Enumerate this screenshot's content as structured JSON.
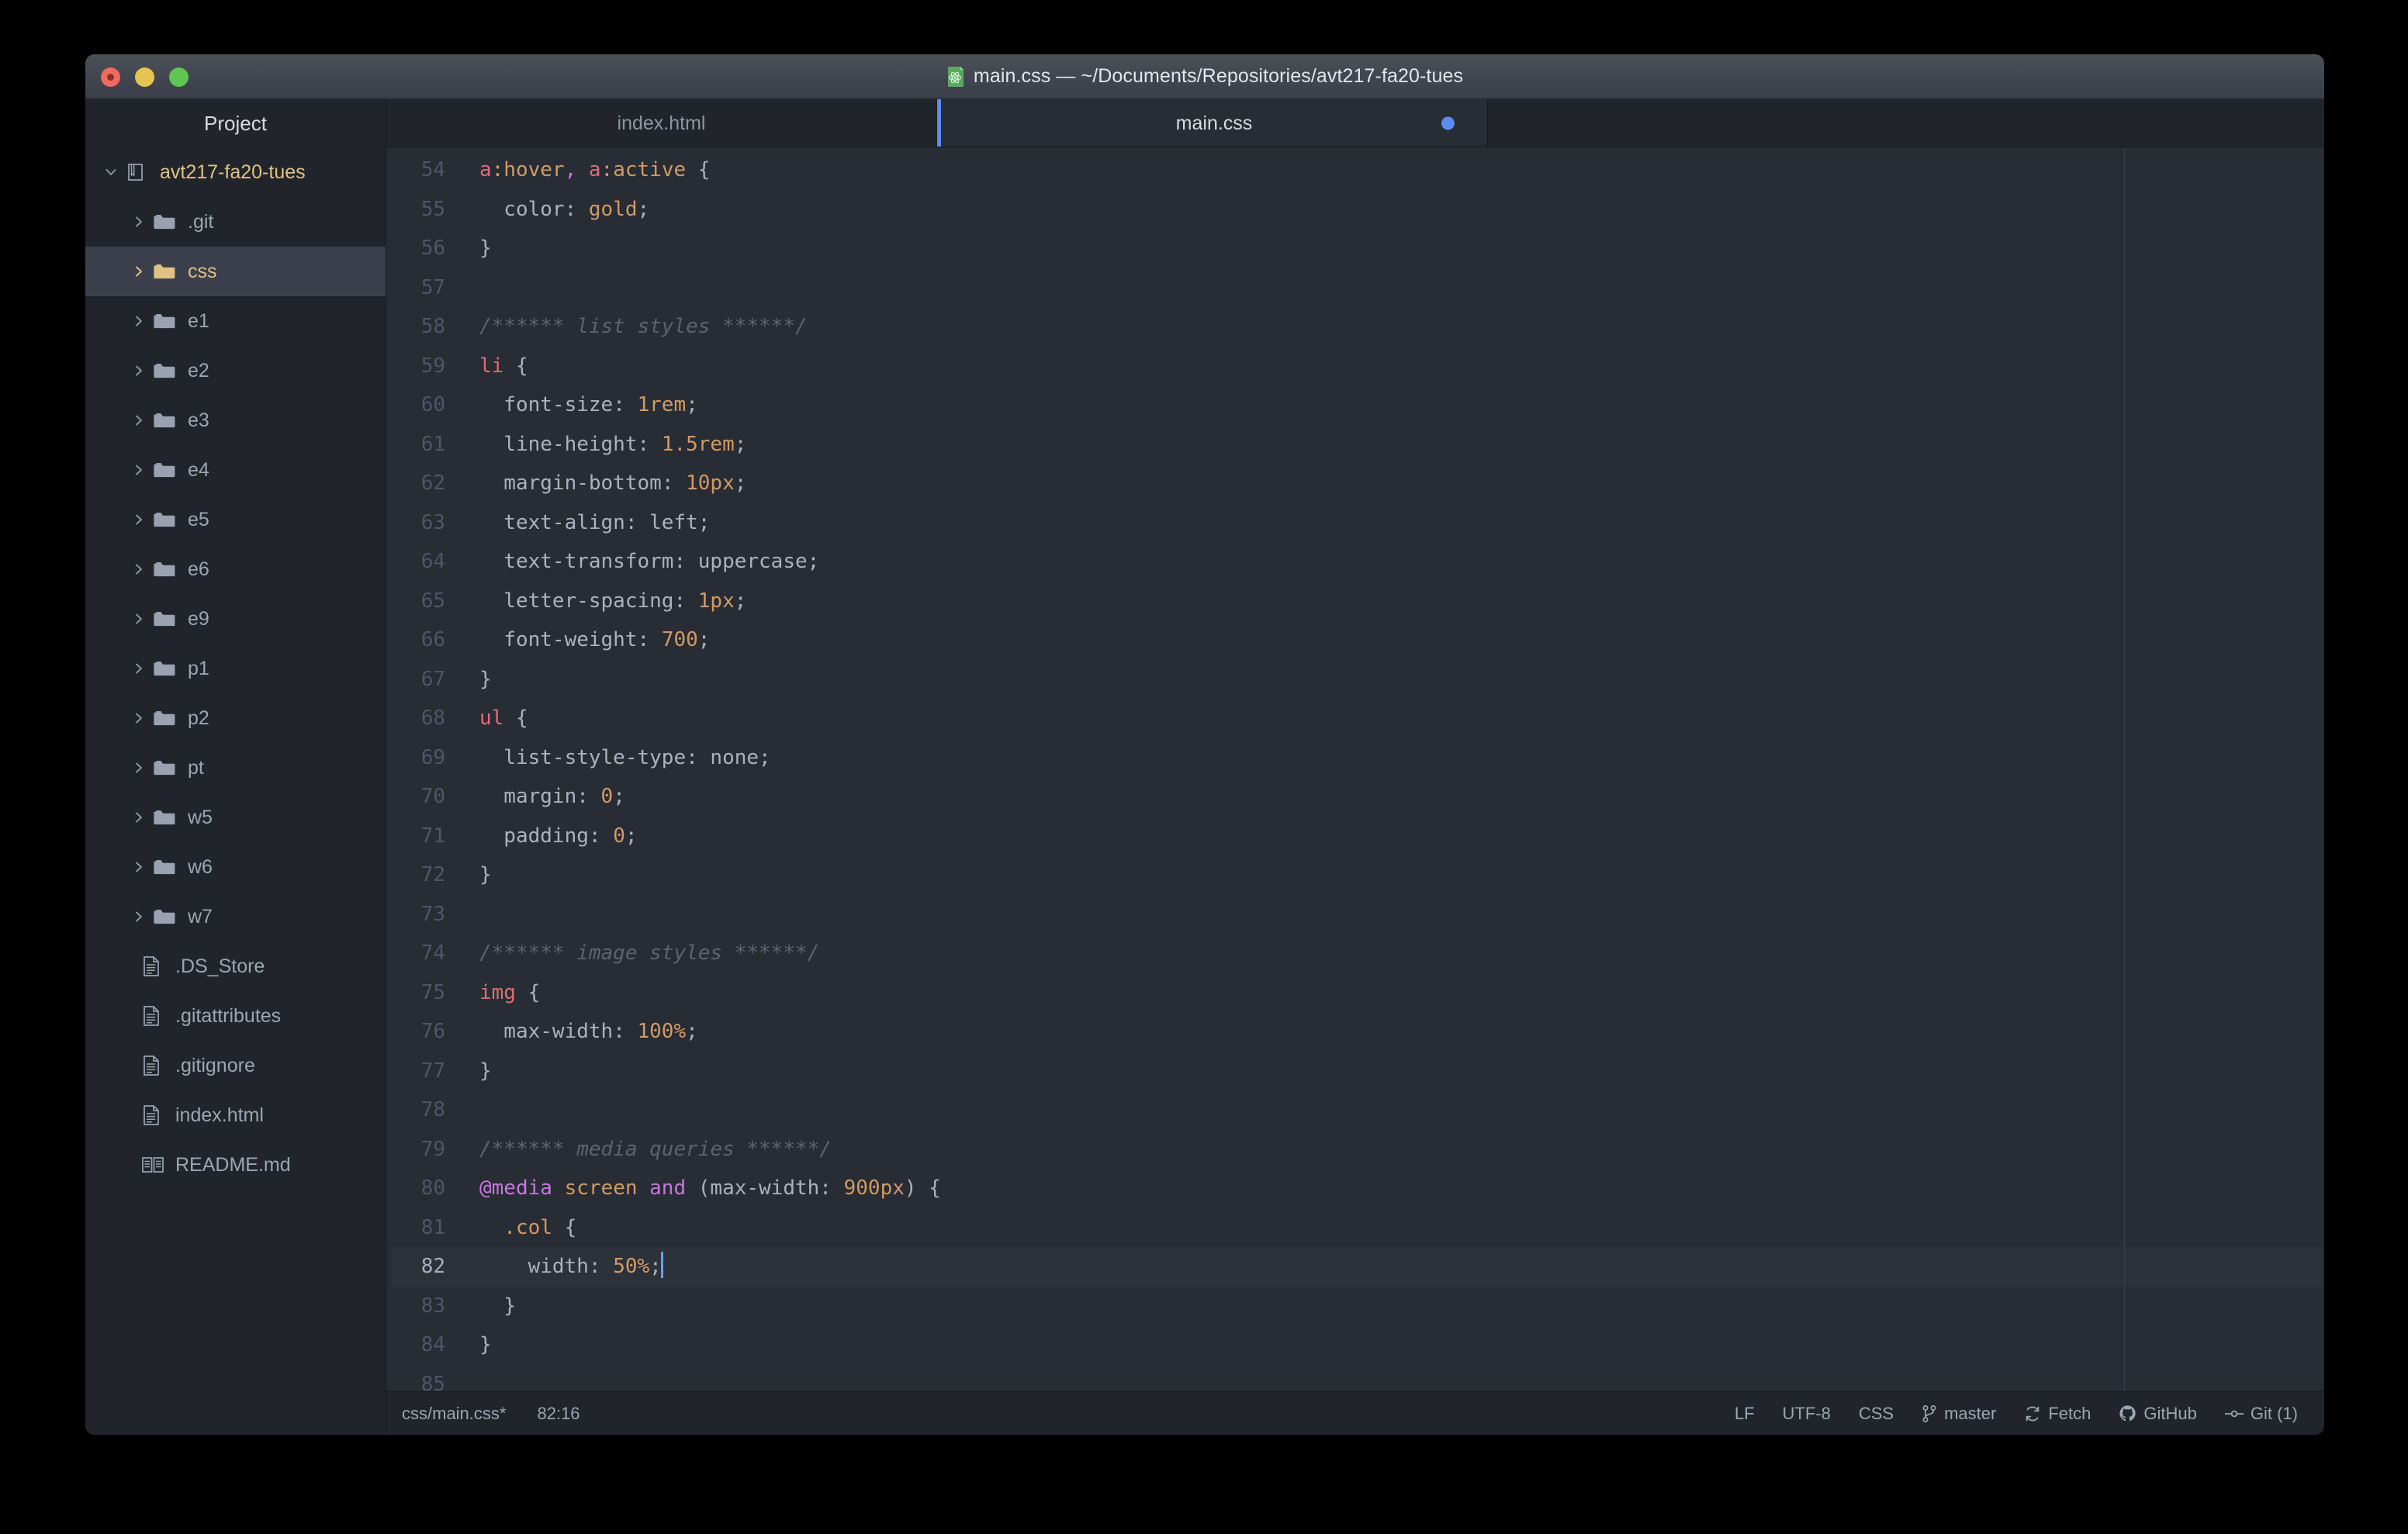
{
  "window": {
    "title": "main.css — ~/Documents/Repositories/avt217-fa20-tues",
    "app_icon": "atom-icon"
  },
  "traffic_lights": {
    "close_label": "close",
    "minimize_label": "minimize",
    "maximize_label": "maximize",
    "close_color": "#ee6a5f",
    "minimize_color": "#e5c450",
    "maximize_color": "#61c554"
  },
  "sidebar": {
    "title": "Project",
    "root": {
      "label": "avt217-fa20-tues",
      "icon": "repo-icon",
      "expanded": true
    },
    "items": [
      {
        "label": ".git",
        "type": "folder",
        "icon": "folder-icon",
        "selected": false
      },
      {
        "label": "css",
        "type": "folder",
        "icon": "folder-icon",
        "selected": true
      },
      {
        "label": "e1",
        "type": "folder",
        "icon": "folder-icon",
        "selected": false
      },
      {
        "label": "e2",
        "type": "folder",
        "icon": "folder-icon",
        "selected": false
      },
      {
        "label": "e3",
        "type": "folder",
        "icon": "folder-icon",
        "selected": false
      },
      {
        "label": "e4",
        "type": "folder",
        "icon": "folder-icon",
        "selected": false
      },
      {
        "label": "e5",
        "type": "folder",
        "icon": "folder-icon",
        "selected": false
      },
      {
        "label": "e6",
        "type": "folder",
        "icon": "folder-icon",
        "selected": false
      },
      {
        "label": "e9",
        "type": "folder",
        "icon": "folder-icon",
        "selected": false
      },
      {
        "label": "p1",
        "type": "folder",
        "icon": "folder-icon",
        "selected": false
      },
      {
        "label": "p2",
        "type": "folder",
        "icon": "folder-icon",
        "selected": false
      },
      {
        "label": "pt",
        "type": "folder",
        "icon": "folder-icon",
        "selected": false
      },
      {
        "label": "w5",
        "type": "folder",
        "icon": "folder-icon",
        "selected": false
      },
      {
        "label": "w6",
        "type": "folder",
        "icon": "folder-icon",
        "selected": false
      },
      {
        "label": "w7",
        "type": "folder",
        "icon": "folder-icon",
        "selected": false
      },
      {
        "label": ".DS_Store",
        "type": "file",
        "icon": "file-icon",
        "selected": false
      },
      {
        "label": ".gitattributes",
        "type": "file",
        "icon": "file-icon",
        "selected": false
      },
      {
        "label": ".gitignore",
        "type": "file",
        "icon": "file-icon",
        "selected": false
      },
      {
        "label": "index.html",
        "type": "file",
        "icon": "file-icon",
        "selected": false
      },
      {
        "label": "README.md",
        "type": "file",
        "icon": "book-icon",
        "selected": false
      }
    ]
  },
  "tabs": [
    {
      "label": "index.html",
      "active": false,
      "modified": false
    },
    {
      "label": "main.css",
      "active": true,
      "modified": true
    }
  ],
  "editor": {
    "accent_color": "#5b8cf0",
    "first_line": 54,
    "active_line": 82,
    "lines": [
      {
        "n": 54,
        "gutter": "",
        "tokens": [
          {
            "t": "a",
            "c": "t-sel"
          },
          {
            "t": ":hover",
            "c": "t-pseudo"
          },
          {
            "t": ",",
            "c": "t-comma"
          },
          {
            "t": " ",
            "c": "t-plain"
          },
          {
            "t": "a",
            "c": "t-sel"
          },
          {
            "t": ":active",
            "c": "t-pseudo"
          },
          {
            "t": " {",
            "c": "t-punct"
          }
        ]
      },
      {
        "n": 55,
        "gutter": "",
        "tokens": [
          {
            "t": "  color",
            "c": "t-prop"
          },
          {
            "t": ": ",
            "c": "t-punct"
          },
          {
            "t": "gold",
            "c": "t-num"
          },
          {
            "t": ";",
            "c": "t-punct"
          }
        ]
      },
      {
        "n": 56,
        "gutter": "",
        "tokens": [
          {
            "t": "}",
            "c": "t-punct"
          }
        ]
      },
      {
        "n": 57,
        "gutter": "",
        "tokens": []
      },
      {
        "n": 58,
        "gutter": "",
        "tokens": [
          {
            "t": "/****** list styles ******/",
            "c": "t-cmt"
          }
        ]
      },
      {
        "n": 59,
        "gutter": "",
        "tokens": [
          {
            "t": "li",
            "c": "t-sel"
          },
          {
            "t": " {",
            "c": "t-punct"
          }
        ]
      },
      {
        "n": 60,
        "gutter": "mod",
        "tokens": [
          {
            "t": "  font-size",
            "c": "t-prop"
          },
          {
            "t": ": ",
            "c": "t-punct"
          },
          {
            "t": "1rem",
            "c": "t-num"
          },
          {
            "t": ";",
            "c": "t-punct"
          }
        ]
      },
      {
        "n": 61,
        "gutter": "mod",
        "tokens": [
          {
            "t": "  line-height",
            "c": "t-prop"
          },
          {
            "t": ": ",
            "c": "t-punct"
          },
          {
            "t": "1.5rem",
            "c": "t-num"
          },
          {
            "t": ";",
            "c": "t-punct"
          }
        ]
      },
      {
        "n": 62,
        "gutter": "",
        "tokens": [
          {
            "t": "  margin-bottom",
            "c": "t-prop"
          },
          {
            "t": ": ",
            "c": "t-punct"
          },
          {
            "t": "10px",
            "c": "t-num"
          },
          {
            "t": ";",
            "c": "t-punct"
          }
        ]
      },
      {
        "n": 63,
        "gutter": "",
        "tokens": [
          {
            "t": "  text-align",
            "c": "t-prop"
          },
          {
            "t": ": ",
            "c": "t-punct"
          },
          {
            "t": "left",
            "c": "t-kw"
          },
          {
            "t": ";",
            "c": "t-punct"
          }
        ]
      },
      {
        "n": 64,
        "gutter": "",
        "tokens": [
          {
            "t": "  text-transform",
            "c": "t-prop"
          },
          {
            "t": ": ",
            "c": "t-punct"
          },
          {
            "t": "uppercase",
            "c": "t-kw"
          },
          {
            "t": ";",
            "c": "t-punct"
          }
        ]
      },
      {
        "n": 65,
        "gutter": "",
        "tokens": [
          {
            "t": "  letter-spacing",
            "c": "t-prop"
          },
          {
            "t": ": ",
            "c": "t-punct"
          },
          {
            "t": "1px",
            "c": "t-num"
          },
          {
            "t": ";",
            "c": "t-punct"
          }
        ]
      },
      {
        "n": 66,
        "gutter": "",
        "tokens": [
          {
            "t": "  font-weight",
            "c": "t-prop"
          },
          {
            "t": ": ",
            "c": "t-punct"
          },
          {
            "t": "700",
            "c": "t-num"
          },
          {
            "t": ";",
            "c": "t-punct"
          }
        ]
      },
      {
        "n": 67,
        "gutter": "",
        "tokens": [
          {
            "t": "}",
            "c": "t-punct"
          }
        ]
      },
      {
        "n": 68,
        "gutter": "",
        "tokens": [
          {
            "t": "ul",
            "c": "t-sel"
          },
          {
            "t": " {",
            "c": "t-punct"
          }
        ]
      },
      {
        "n": 69,
        "gutter": "",
        "tokens": [
          {
            "t": "  list-style-type",
            "c": "t-prop"
          },
          {
            "t": ": ",
            "c": "t-punct"
          },
          {
            "t": "none",
            "c": "t-kw"
          },
          {
            "t": ";",
            "c": "t-punct"
          }
        ]
      },
      {
        "n": 70,
        "gutter": "",
        "tokens": [
          {
            "t": "  margin",
            "c": "t-prop"
          },
          {
            "t": ": ",
            "c": "t-punct"
          },
          {
            "t": "0",
            "c": "t-num"
          },
          {
            "t": ";",
            "c": "t-punct"
          }
        ]
      },
      {
        "n": 71,
        "gutter": "",
        "tokens": [
          {
            "t": "  padding",
            "c": "t-prop"
          },
          {
            "t": ": ",
            "c": "t-punct"
          },
          {
            "t": "0",
            "c": "t-num"
          },
          {
            "t": ";",
            "c": "t-punct"
          }
        ]
      },
      {
        "n": 72,
        "gutter": "",
        "tokens": [
          {
            "t": "}",
            "c": "t-punct"
          }
        ]
      },
      {
        "n": 73,
        "gutter": "",
        "tokens": []
      },
      {
        "n": 74,
        "gutter": "",
        "tokens": [
          {
            "t": "/****** image styles ******/",
            "c": "t-cmt"
          }
        ]
      },
      {
        "n": 75,
        "gutter": "",
        "tokens": [
          {
            "t": "img",
            "c": "t-sel"
          },
          {
            "t": " {",
            "c": "t-punct"
          }
        ]
      },
      {
        "n": 76,
        "gutter": "",
        "tokens": [
          {
            "t": "  max-width",
            "c": "t-prop"
          },
          {
            "t": ": ",
            "c": "t-punct"
          },
          {
            "t": "100%",
            "c": "t-num"
          },
          {
            "t": ";",
            "c": "t-punct"
          }
        ]
      },
      {
        "n": 77,
        "gutter": "",
        "tokens": [
          {
            "t": "}",
            "c": "t-punct"
          }
        ]
      },
      {
        "n": 78,
        "gutter": "added",
        "tokens": []
      },
      {
        "n": 79,
        "gutter": "added",
        "tokens": [
          {
            "t": "/****** media queries ******/",
            "c": "t-cmt"
          }
        ]
      },
      {
        "n": 80,
        "gutter": "added",
        "tokens": [
          {
            "t": "@media",
            "c": "t-at"
          },
          {
            "t": " ",
            "c": "t-plain"
          },
          {
            "t": "screen",
            "c": "t-media"
          },
          {
            "t": " ",
            "c": "t-plain"
          },
          {
            "t": "and",
            "c": "t-at"
          },
          {
            "t": " (max-width: ",
            "c": "t-punct"
          },
          {
            "t": "900px",
            "c": "t-num"
          },
          {
            "t": ") {",
            "c": "t-punct"
          }
        ]
      },
      {
        "n": 81,
        "gutter": "added",
        "tokens": [
          {
            "t": "  .col",
            "c": "t-class"
          },
          {
            "t": " {",
            "c": "t-punct"
          }
        ]
      },
      {
        "n": 82,
        "gutter": "added",
        "active": true,
        "caret": true,
        "tokens": [
          {
            "t": "    width",
            "c": "t-prop"
          },
          {
            "t": ": ",
            "c": "t-punct"
          },
          {
            "t": "50%",
            "c": "t-num"
          },
          {
            "t": ";",
            "c": "t-punct"
          }
        ]
      },
      {
        "n": 83,
        "gutter": "added",
        "tokens": [
          {
            "t": "  }",
            "c": "t-punct"
          }
        ]
      },
      {
        "n": 84,
        "gutter": "added",
        "tokens": [
          {
            "t": "}",
            "c": "t-punct"
          }
        ]
      },
      {
        "n": 85,
        "gutter": "",
        "tokens": []
      }
    ]
  },
  "statusbar": {
    "file_path": "css/main.css*",
    "cursor_position": "82:16",
    "line_ending": "LF",
    "encoding": "UTF-8",
    "grammar": "CSS",
    "branch": "master",
    "branch_icon": "git-branch-icon",
    "fetch": "Fetch",
    "fetch_icon": "sync-icon",
    "github": "GitHub",
    "github_icon": "github-icon",
    "git": "Git (1)",
    "git_icon": "git-commit-icon"
  }
}
